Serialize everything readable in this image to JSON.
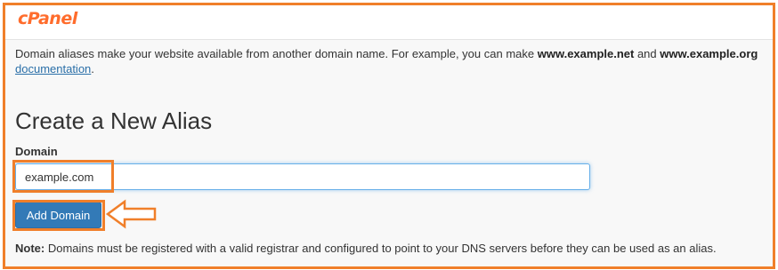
{
  "brand": {
    "logo_text": "cPanel",
    "logo_color": "#ff6c2c"
  },
  "intro": {
    "text_before": "Domain aliases make your website available from another domain name. For example, you can make ",
    "example_domain_1": "www.example.net",
    "text_between": " and ",
    "example_domain_2": "www.example.org",
    "link_text": "documentation",
    "link_suffix": "."
  },
  "form": {
    "title": "Create a New Alias",
    "domain_label": "Domain",
    "domain_value": "example.com",
    "submit_label": "Add Domain"
  },
  "note": {
    "label": "Note:",
    "text": " Domains must be registered with a valid registrar and configured to point to your DNS servers before they can be used as an alias."
  },
  "colors": {
    "annotation_orange": "#f07f2a",
    "button_blue": "#337ab7",
    "link_blue": "#2a6fa8"
  },
  "annotations": {
    "arrow_icon": "left-arrow-icon"
  }
}
